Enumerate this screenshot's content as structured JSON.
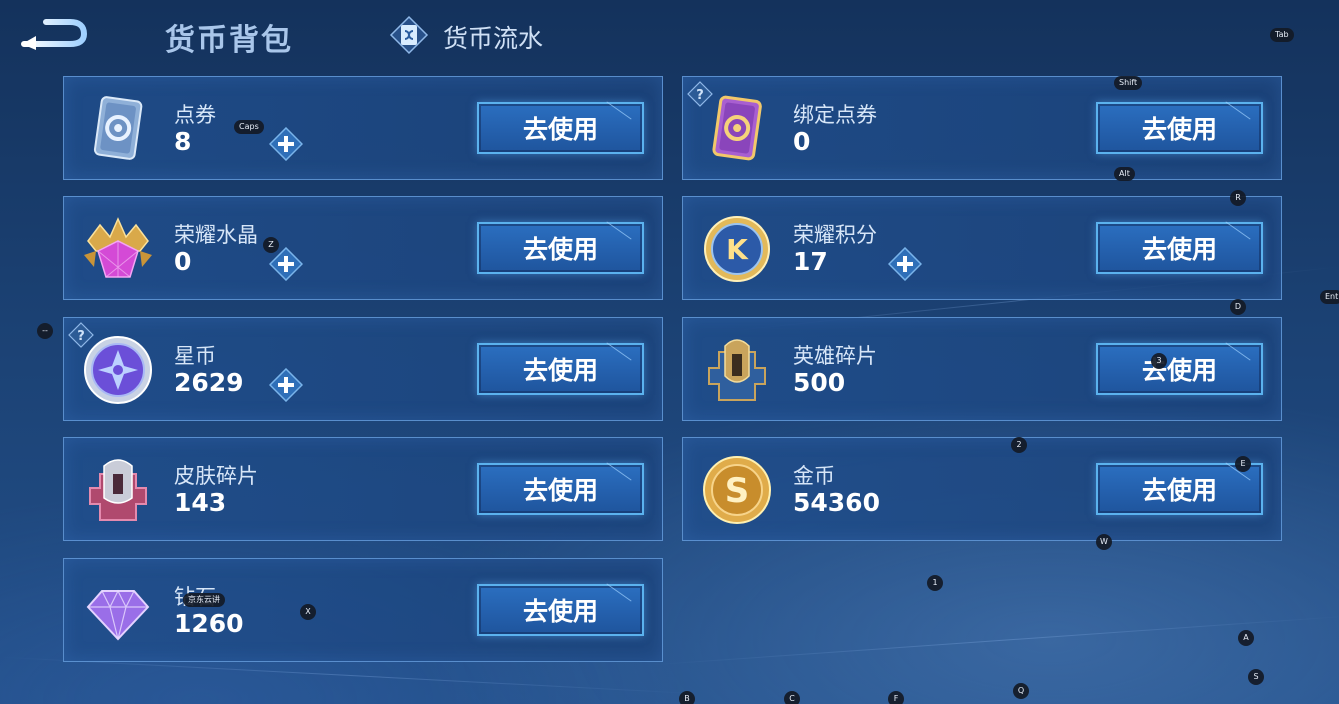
{
  "header": {
    "title": "货币背包",
    "flow_link": "货币流水"
  },
  "cards": [
    {
      "name": "点券",
      "value": "8",
      "button": "去使用",
      "icon": "coupon-ticket-icon",
      "has_plus": true
    },
    {
      "name": "绑定点券",
      "value": "0",
      "button": "去使用",
      "icon": "bound-coupon-icon",
      "has_help": true
    },
    {
      "name": "荣耀水晶",
      "value": "0",
      "button": "去使用",
      "icon": "glory-crystal-icon",
      "has_plus": true
    },
    {
      "name": "荣耀积分",
      "value": "17",
      "button": "去使用",
      "icon": "glory-points-icon",
      "has_plus": true
    },
    {
      "name": "星币",
      "value": "2629",
      "button": "去使用",
      "icon": "star-coin-icon",
      "has_plus": true,
      "has_help": true
    },
    {
      "name": "英雄碎片",
      "value": "500",
      "button": "去使用",
      "icon": "hero-fragment-icon"
    },
    {
      "name": "皮肤碎片",
      "value": "143",
      "button": "去使用",
      "icon": "skin-fragment-icon"
    },
    {
      "name": "金币",
      "value": "54360",
      "button": "去使用",
      "icon": "gold-coin-icon"
    },
    {
      "name": "钻石",
      "value": "1260",
      "button": "去使用",
      "icon": "diamond-icon"
    }
  ],
  "overlay_keys": [
    "Tab",
    "Shift",
    "Caps",
    "Alt",
    "R",
    "Z",
    "D",
    "Ent",
    "--",
    "3",
    "2",
    "E",
    "W",
    "1",
    "京东云讲",
    "X",
    "A",
    "S",
    "Q",
    "B",
    "C",
    "F"
  ],
  "colors": {
    "background": "#1b4173",
    "card_border": "#6ea5e6",
    "button_fill": "#2460ad",
    "button_border": "#5bb2ee"
  }
}
